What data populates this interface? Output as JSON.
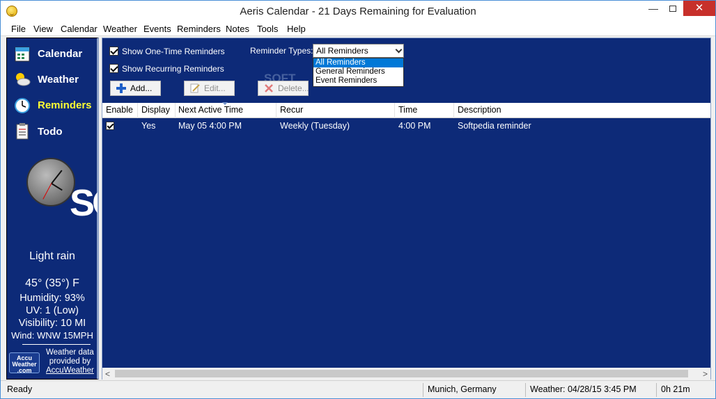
{
  "window": {
    "title": "Aeris Calendar - 21 Days Remaining for Evaluation"
  },
  "menu": [
    "File",
    "View",
    "Calendar",
    "Weather",
    "Events",
    "Reminders",
    "Notes",
    "Tools",
    "Help"
  ],
  "sidebar": {
    "nav": [
      {
        "label": "Calendar",
        "icon": "calendar-icon",
        "active": false
      },
      {
        "label": "Weather",
        "icon": "weather-sun-cloud-icon",
        "active": false
      },
      {
        "label": "Reminders",
        "icon": "alarm-clock-icon",
        "active": true
      },
      {
        "label": "Todo",
        "icon": "todo-list-icon",
        "active": false
      }
    ],
    "watermark": "SO",
    "weather": {
      "condition": "Light rain",
      "temperature": "45° (35°) F",
      "humidity": "Humidity: 93%",
      "uv": "UV: 1 (Low)",
      "visibility": "Visibility: 10 MI",
      "wind": "Wind: WNW 15MPH",
      "provider_logo": [
        "Accu",
        "Weather",
        ".com"
      ],
      "provided_line1": "Weather data",
      "provided_line2": "provided by",
      "provider_link": "AccuWeather"
    }
  },
  "filters": {
    "show_one_time": {
      "label": "Show One-Time Reminders",
      "checked": true
    },
    "show_recurring": {
      "label": "Show Recurring Reminders",
      "checked": true
    },
    "reminder_types_label": "Reminder Types:",
    "reminder_types_value": "All Reminders",
    "reminder_types_options": [
      "All Reminders",
      "General Reminders",
      "Event Reminders"
    ]
  },
  "watermark_main": "SOFT",
  "toolbar": {
    "add": "Add...",
    "edit": "Edit...",
    "delete": "Delete..."
  },
  "table": {
    "columns": [
      "Enable",
      "Display",
      "Next Active Time",
      "Recur",
      "Time",
      "Description"
    ],
    "rows": [
      {
        "enabled": true,
        "display": "Yes",
        "next_active": "May 05 4:00 PM",
        "recur": "Weekly (Tuesday)",
        "time": "4:00 PM",
        "description": "Softpedia reminder"
      }
    ]
  },
  "status": {
    "state": "Ready",
    "location": "Munich, Germany",
    "weather_time": "Weather: 04/28/15 3:45 PM",
    "elapsed": "0h 21m"
  },
  "colors": {
    "panel_bg": "#0d2a78",
    "active_nav": "#ffff33",
    "close_button": "#c7302b",
    "selection": "#0078d7"
  }
}
